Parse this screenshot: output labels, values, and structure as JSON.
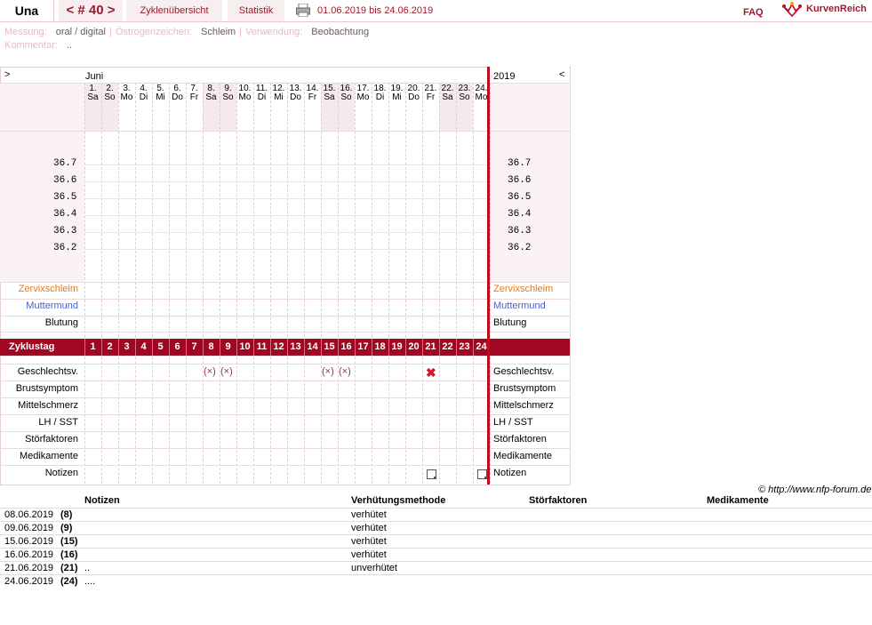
{
  "header": {
    "name": "Una",
    "cycle": "< # 40 >",
    "tabs": [
      "Zyklenübersicht",
      "Statistik"
    ],
    "range": "01.06.2019 bis 24.06.2019",
    "faq": "FAQ",
    "logo": "KurvenReich"
  },
  "meta": {
    "messung_label": "Messung:",
    "messung": "oral / digital",
    "oestro_label": "Östrogenzeichen:",
    "oestro": "Schleim",
    "verw_label": "Verwendung:",
    "verw": "Beobachtung",
    "komm_label": "Kommentar:",
    "komm": ".."
  },
  "chart": {
    "nav_prev": ">",
    "nav_next": "<",
    "month": "Juni",
    "year": "2019",
    "days": [
      {
        "d": "1.",
        "w": "Sa",
        "we": true
      },
      {
        "d": "2.",
        "w": "So",
        "we": true
      },
      {
        "d": "3.",
        "w": "Mo",
        "we": false
      },
      {
        "d": "4.",
        "w": "Di",
        "we": false
      },
      {
        "d": "5.",
        "w": "Mi",
        "we": false
      },
      {
        "d": "6.",
        "w": "Do",
        "we": false
      },
      {
        "d": "7.",
        "w": "Fr",
        "we": false
      },
      {
        "d": "8.",
        "w": "Sa",
        "we": true
      },
      {
        "d": "9.",
        "w": "So",
        "we": true
      },
      {
        "d": "10.",
        "w": "Mo",
        "we": false
      },
      {
        "d": "11.",
        "w": "Di",
        "we": false
      },
      {
        "d": "12.",
        "w": "Mi",
        "we": false
      },
      {
        "d": "13.",
        "w": "Do",
        "we": false
      },
      {
        "d": "14.",
        "w": "Fr",
        "we": false
      },
      {
        "d": "15.",
        "w": "Sa",
        "we": true
      },
      {
        "d": "16.",
        "w": "So",
        "we": true
      },
      {
        "d": "17.",
        "w": "Mo",
        "we": false
      },
      {
        "d": "18.",
        "w": "Di",
        "we": false
      },
      {
        "d": "19.",
        "w": "Mi",
        "we": false
      },
      {
        "d": "20.",
        "w": "Do",
        "we": false
      },
      {
        "d": "21.",
        "w": "Fr",
        "we": false
      },
      {
        "d": "22.",
        "w": "Sa",
        "we": true
      },
      {
        "d": "23.",
        "w": "So",
        "we": true
      },
      {
        "d": "24.",
        "w": "Mo",
        "we": false
      }
    ],
    "temps": [
      "36.7",
      "36.6",
      "36.5",
      "36.4",
      "36.3",
      "36.2"
    ],
    "rows_top": [
      "Zervixschleim",
      "Muttermund",
      "Blutung"
    ],
    "zyklustag": "Zyklustag",
    "zyklus_days": [
      "1",
      "2",
      "3",
      "4",
      "5",
      "6",
      "7",
      "8",
      "9",
      "10",
      "11",
      "12",
      "13",
      "14",
      "15",
      "16",
      "17",
      "18",
      "19",
      "20",
      "21",
      "22",
      "23",
      "24"
    ],
    "rows_bottom": [
      "Geschlechtsv.",
      "Brustsymptom",
      "Mittelschmerz",
      "LH / SST",
      "Störfaktoren",
      "Medikamente",
      "Notizen"
    ],
    "gv_marks": [
      {
        "day": 8,
        "sym": "(×)"
      },
      {
        "day": 9,
        "sym": "(×)"
      },
      {
        "day": 15,
        "sym": "(×)"
      },
      {
        "day": 16,
        "sym": "(×)"
      },
      {
        "day": 21,
        "sym": "✖"
      }
    ],
    "note_days": [
      21,
      24
    ],
    "colors": {
      "accent": "#a10723",
      "line": "#c00a1e",
      "weekend": "#f6e9ec"
    }
  },
  "copyright": "© http://www.nfp-forum.de",
  "table": {
    "headers": [
      "Notizen",
      "Verhütungsmethode",
      "Störfaktoren",
      "Medikamente"
    ],
    "rows": [
      {
        "date": "08.06.2019",
        "day": "(8)",
        "note": "",
        "method": "verhütet"
      },
      {
        "date": "09.06.2019",
        "day": "(9)",
        "note": "",
        "method": "verhütet"
      },
      {
        "date": "15.06.2019",
        "day": "(15)",
        "note": "",
        "method": "verhütet"
      },
      {
        "date": "16.06.2019",
        "day": "(16)",
        "note": "",
        "method": "verhütet"
      },
      {
        "date": "21.06.2019",
        "day": "(21)",
        "note": "..",
        "method": "unverhütet"
      },
      {
        "date": "24.06.2019",
        "day": "(24)",
        "note": "....",
        "method": ""
      }
    ]
  }
}
